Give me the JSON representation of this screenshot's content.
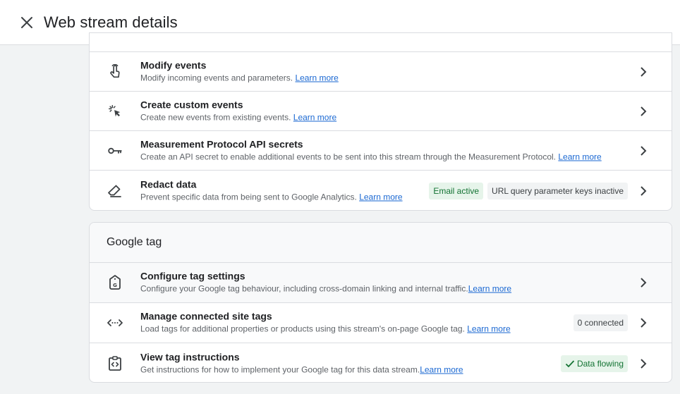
{
  "header": {
    "title": "Web stream details"
  },
  "events": {
    "rows": [
      {
        "title": "Modify events",
        "desc": "Modify incoming events and parameters.",
        "link": "Learn more"
      },
      {
        "title": "Create custom events",
        "desc": "Create new events from existing events.",
        "link": "Learn more"
      },
      {
        "title": "Measurement Protocol API secrets",
        "desc": "Create an API secret to enable additional events to be sent into this stream through the Measurement Protocol.",
        "link": "Learn more"
      },
      {
        "title": "Redact data",
        "desc": "Prevent specific data from being sent to Google Analytics.",
        "link": "Learn more",
        "chips": [
          "Email active",
          "URL query parameter keys inactive"
        ]
      }
    ]
  },
  "google_tag": {
    "title": "Google tag",
    "rows": [
      {
        "title": "Configure tag settings",
        "desc": "Configure your Google tag behaviour, including cross-domain linking and internal traffic.",
        "link": "Learn more"
      },
      {
        "title": "Manage connected site tags",
        "desc": "Load tags for additional properties or products using this stream's on-page Google tag.",
        "link": "Learn more",
        "badge": "0 connected"
      },
      {
        "title": "View tag instructions",
        "desc": "Get instructions for how to implement your Google tag for this data stream.",
        "link": "Learn more",
        "badge": "Data flowing"
      }
    ]
  },
  "colors": {
    "link": "#1967d2",
    "green_chip_bg": "#e6f4ea",
    "green_chip_text": "#137333"
  }
}
